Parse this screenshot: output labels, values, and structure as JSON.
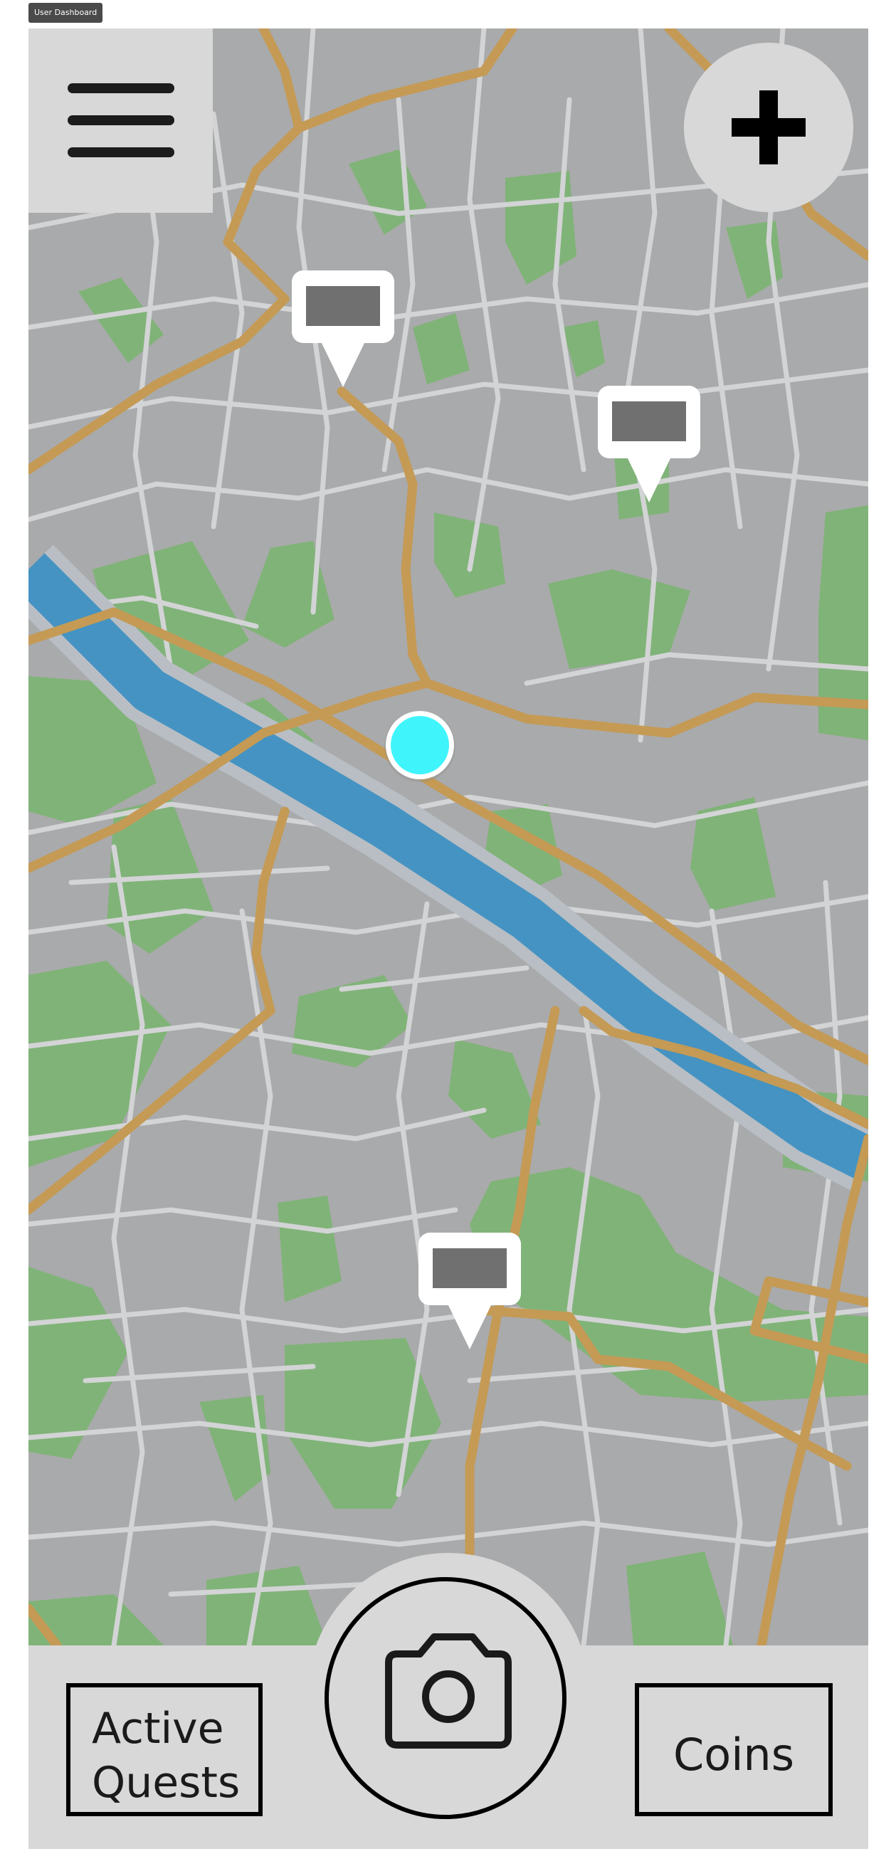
{
  "window": {
    "title": "User Dashboard"
  },
  "header": {
    "menu_icon": "hamburger-menu-icon",
    "add_icon": "plus-icon"
  },
  "map": {
    "icon_names": [
      "quest-pin-icon",
      "user-location-icon"
    ],
    "quest_pin_count": 3
  },
  "bottom_bar": {
    "active_quests_label": "Active\nQuests",
    "camera_icon": "camera-icon",
    "coins_label": "Coins"
  },
  "colors": {
    "map_background": "#a9aaab",
    "street": "#d3d4d6",
    "park": "#80b378",
    "river": "#4593c2",
    "river_bank": "#b8bec4",
    "main_road": "#c49a55",
    "user_location": "#40f4fb",
    "pin_body": "#ffffff",
    "pin_screen": "#707070",
    "panel": "#d8d8d8",
    "outline": "#000000"
  }
}
